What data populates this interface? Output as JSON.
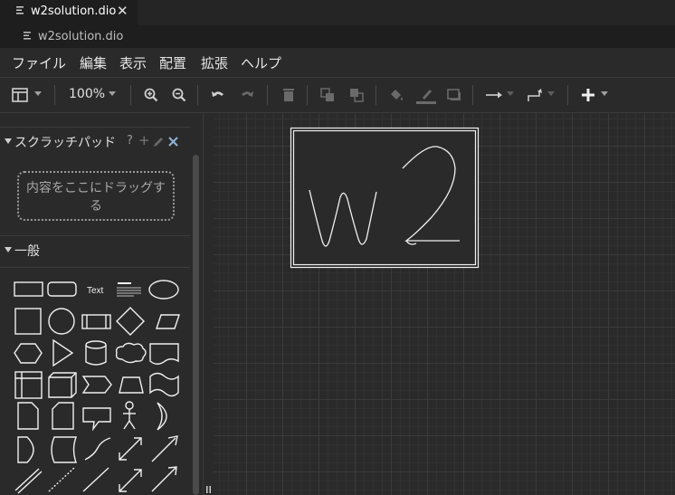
{
  "tab": {
    "filename": "w2solution.dio",
    "close_glyph": "✕"
  },
  "breadcrumb": {
    "filename": "w2solution.dio"
  },
  "menu": [
    "ファイル",
    "編集",
    "表示",
    "配置",
    "拡張",
    "ヘルプ"
  ],
  "toolbar": {
    "zoom": "100%",
    "icons": [
      "layout-panel-icon",
      "zoom-in-icon",
      "zoom-out-icon",
      "undo-icon",
      "redo-icon",
      "delete-icon",
      "to-front-icon",
      "to-back-icon",
      "fill-color-icon",
      "line-color-icon",
      "shadow-icon",
      "connection-icon",
      "waypoints-icon",
      "insert-plus-icon"
    ]
  },
  "sidebar": {
    "scratchpad": {
      "title": "スクラッチパッド",
      "help": "?",
      "add": "+",
      "drop_hint": "内容をここにドラッグする"
    },
    "general": {
      "title": "一般",
      "text_shape_label": "Text"
    }
  },
  "canvas": {
    "drawing_label": "w2"
  },
  "colors": {
    "background": "#2a2a2a",
    "tab_active": "#1e1e1e",
    "grid": "#3b3b3b",
    "shape_stroke": "#f0f0f0"
  }
}
